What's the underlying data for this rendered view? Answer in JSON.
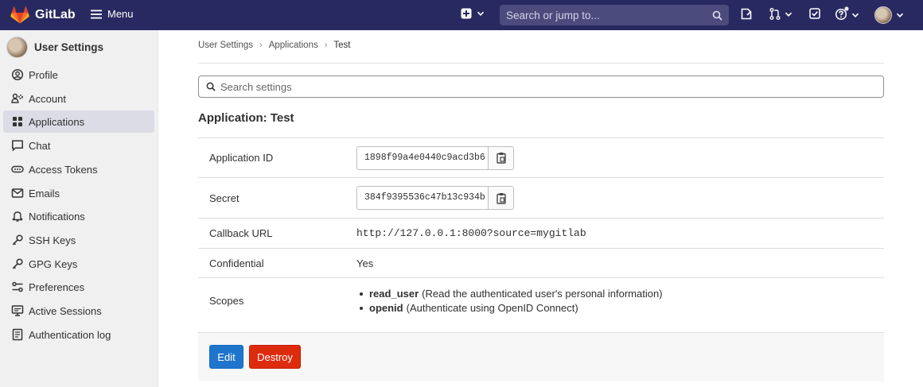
{
  "navbar": {
    "brand": "GitLab",
    "menu_label": "Menu",
    "search_placeholder": "Search or jump to..."
  },
  "sidebar": {
    "title": "User Settings",
    "items": [
      {
        "label": "Profile",
        "icon": "profile-icon"
      },
      {
        "label": "Account",
        "icon": "account-icon"
      },
      {
        "label": "Applications",
        "icon": "applications-icon"
      },
      {
        "label": "Chat",
        "icon": "chat-icon"
      },
      {
        "label": "Access Tokens",
        "icon": "token-icon"
      },
      {
        "label": "Emails",
        "icon": "mail-icon"
      },
      {
        "label": "Notifications",
        "icon": "bell-icon"
      },
      {
        "label": "SSH Keys",
        "icon": "key-icon"
      },
      {
        "label": "GPG Keys",
        "icon": "key-icon"
      },
      {
        "label": "Preferences",
        "icon": "preferences-icon"
      },
      {
        "label": "Active Sessions",
        "icon": "monitor-icon"
      },
      {
        "label": "Authentication log",
        "icon": "log-icon"
      }
    ],
    "active_index": 2
  },
  "breadcrumb": [
    "User Settings",
    "Applications",
    "Test"
  ],
  "settings_search_placeholder": "Search settings",
  "app_title": "Application: Test",
  "details": {
    "application_id_label": "Application ID",
    "application_id_value": "1898f99a4e0440c9acd3b6",
    "secret_label": "Secret",
    "secret_value": "384f9395536c47b13c934b",
    "callback_label": "Callback URL",
    "callback_value": "http://127.0.0.1:8000?source=mygitlab",
    "confidential_label": "Confidential",
    "confidential_value": "Yes",
    "scopes_label": "Scopes",
    "scopes": [
      {
        "name": "read_user",
        "desc": "(Read the authenticated user's personal information)"
      },
      {
        "name": "openid",
        "desc": "(Authenticate using OpenID Connect)"
      }
    ]
  },
  "actions": {
    "edit_label": "Edit",
    "destroy_label": "Destroy"
  },
  "colors": {
    "navbar_bg": "#292961",
    "primary": "#1f75cb",
    "danger": "#dd2b0e"
  }
}
